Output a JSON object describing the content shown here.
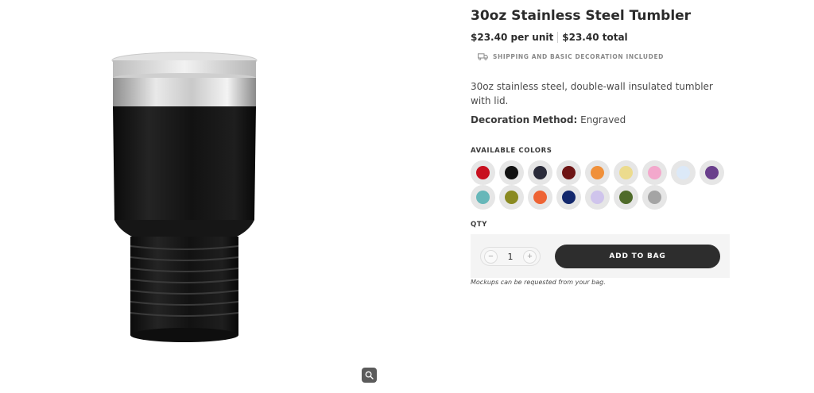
{
  "product": {
    "title": "30oz Stainless Steel Tumbler",
    "price_unit": "$23.40 per unit",
    "price_total": "$23.40 total",
    "shipping_note": "SHIPPING AND BASIC DECORATION INCLUDED",
    "description": "30oz stainless steel, double-wall insulated tumbler with lid.",
    "decoration_label": "Decoration Method:",
    "decoration_value": "Engraved",
    "image_icon": "tumbler-product-image",
    "zoom_icon": "magnifier-icon"
  },
  "colors": {
    "label": "AVAILABLE COLORS",
    "swatches": [
      {
        "color": "#c8101f"
      },
      {
        "color": "#111111"
      },
      {
        "color": "#2a2b3a"
      },
      {
        "color": "#6e1515"
      },
      {
        "color": "#f0903a"
      },
      {
        "color": "#ecdb8d"
      },
      {
        "color": "#f3a8cc"
      },
      {
        "color": "#dce9f8"
      },
      {
        "color": "#6a3f8c"
      },
      {
        "color": "#66b7b9"
      },
      {
        "color": "#8a8a21"
      },
      {
        "color": "#ee6334"
      },
      {
        "color": "#13286d"
      },
      {
        "color": "#cfc4ec"
      },
      {
        "color": "#4f6b2a"
      },
      {
        "color": "#a4a4a4"
      }
    ]
  },
  "quantity": {
    "label": "QTY",
    "value": "1",
    "decrement": "−",
    "increment": "+"
  },
  "actions": {
    "add_to_bag": "ADD TO BAG",
    "mockup_note": "Mockups can be requested from your bag."
  },
  "theme": {
    "button_color": "#2d2d2d",
    "text_color": "#2b2b2b"
  }
}
